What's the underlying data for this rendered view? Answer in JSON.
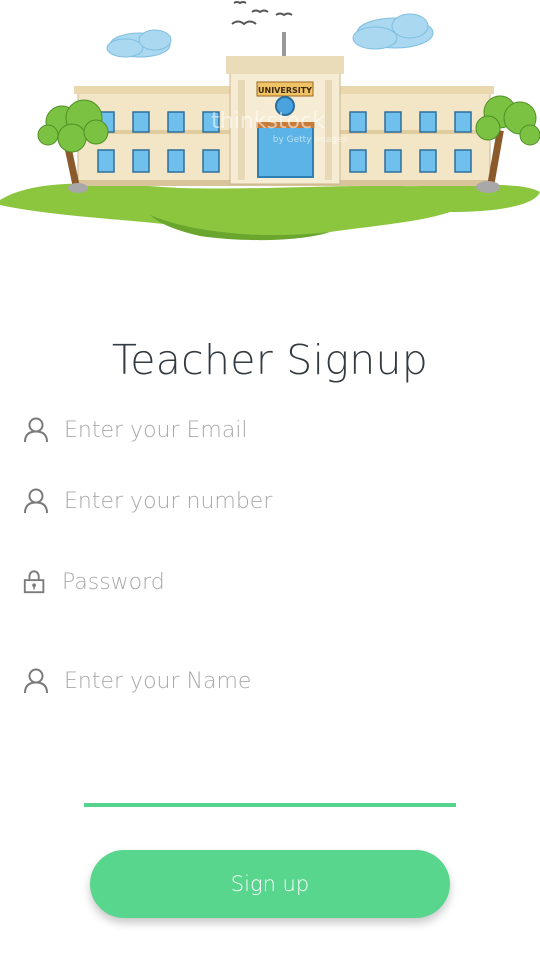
{
  "hero": {
    "sign_text": "UNIVERSITY",
    "watermark": "thinkstock",
    "watermark_sub": "by Getty Images"
  },
  "title": "Teacher Signup",
  "fields": {
    "email": {
      "placeholder": "Enter your Email",
      "icon": "person-icon"
    },
    "number": {
      "placeholder": "Enter your number",
      "icon": "person-icon"
    },
    "password": {
      "placeholder": "Password",
      "icon": "lock-icon"
    },
    "name": {
      "placeholder": "Enter your Name",
      "icon": "person-icon"
    }
  },
  "signup_button": {
    "label": "Sign up"
  },
  "colors": {
    "accent": "#58d68d",
    "title": "#333a40",
    "placeholder": "#a8a8a8",
    "icon": "#7a7a7a"
  }
}
